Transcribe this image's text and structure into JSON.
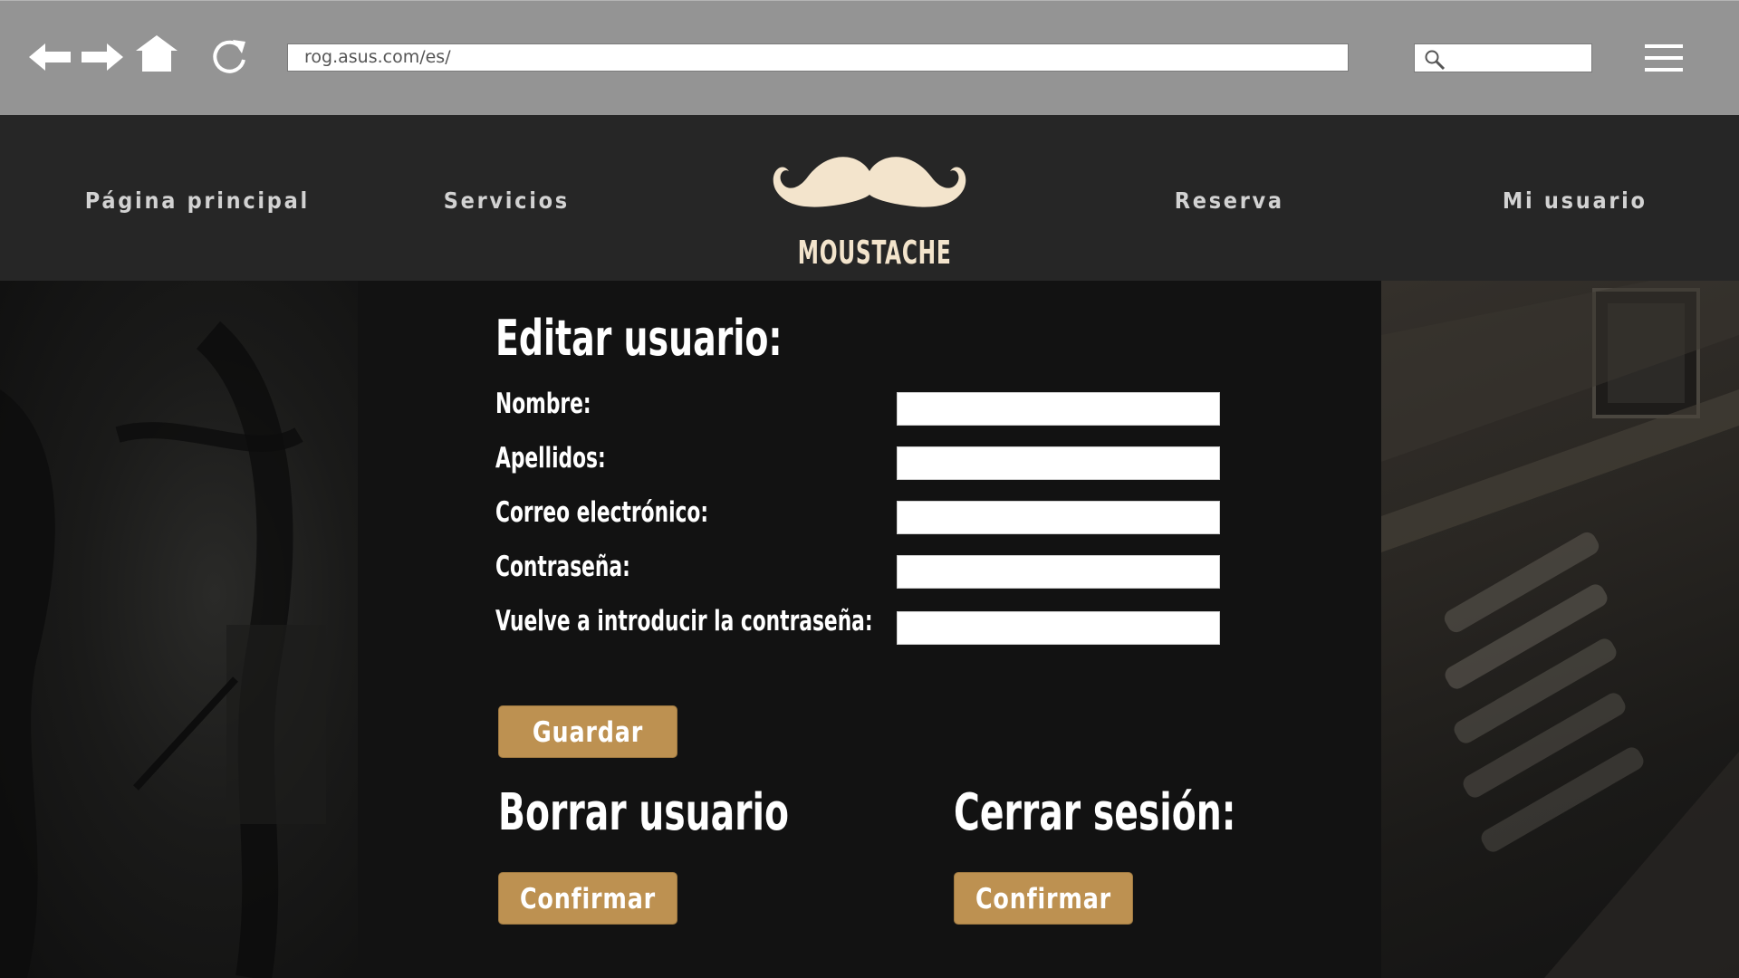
{
  "browser": {
    "url": "rog.asus.com/es/",
    "icons": [
      "back-arrow-icon",
      "forward-arrow-icon",
      "home-icon",
      "reload-icon",
      "search-icon",
      "hamburger-menu-icon"
    ]
  },
  "nav": {
    "home": "Página principal",
    "services": "Servicios",
    "booking": "Reserva",
    "user": "Mi usuario"
  },
  "logo": {
    "text": "MOUSTACHE"
  },
  "form": {
    "title": "Editar usuario:",
    "fields": [
      {
        "label": "Nombre:",
        "value": ""
      },
      {
        "label": "Apellidos:",
        "value": ""
      },
      {
        "label": "Correo electrónico:",
        "value": ""
      },
      {
        "label": "Contraseña:",
        "value": ""
      },
      {
        "label": "Vuelve a introducir la contraseña:",
        "value": ""
      }
    ],
    "save_label": "Guardar"
  },
  "delete_user": {
    "title": "Borrar usuario",
    "button": "Confirmar"
  },
  "logout": {
    "title": "Cerrar sesión:",
    "button": "Confirmar"
  },
  "colors": {
    "chrome": "#949494",
    "header": "#262626",
    "panel": "#121212",
    "button_gold": "#bd9151",
    "logo_cream": "#f3e4cc"
  }
}
